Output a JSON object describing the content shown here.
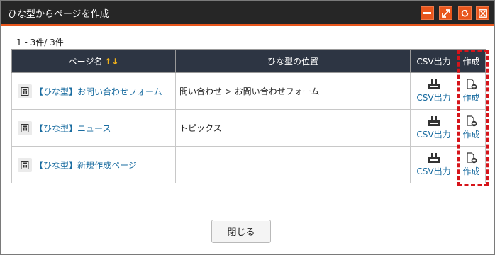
{
  "window": {
    "title": "ひな型からページを作成"
  },
  "list": {
    "count_text": "1 - 3件/ 3件",
    "headers": {
      "page_name": "ページ名",
      "template_location": "ひな型の位置",
      "csv_output": "CSV出力",
      "create": "作成"
    },
    "rows": [
      {
        "page_name": "【ひな型】お問い合わせフォーム",
        "location": "問い合わせ > お問い合わせフォーム",
        "csv_label": "CSV出力",
        "create_label": "作成"
      },
      {
        "page_name": "【ひな型】ニュース",
        "location": "トピックス",
        "csv_label": "CSV出力",
        "create_label": "作成"
      },
      {
        "page_name": "【ひな型】新規作成ページ",
        "location": "",
        "csv_label": "CSV出力",
        "create_label": "作成"
      }
    ]
  },
  "footer": {
    "close_label": "閉じる"
  },
  "colors": {
    "title_bar": "#262626",
    "accent": "#e8561c",
    "header_bg": "#2d3543",
    "link": "#1a6ca0",
    "sort_arrows": "#f2b21a",
    "highlight": "#d6141a"
  }
}
